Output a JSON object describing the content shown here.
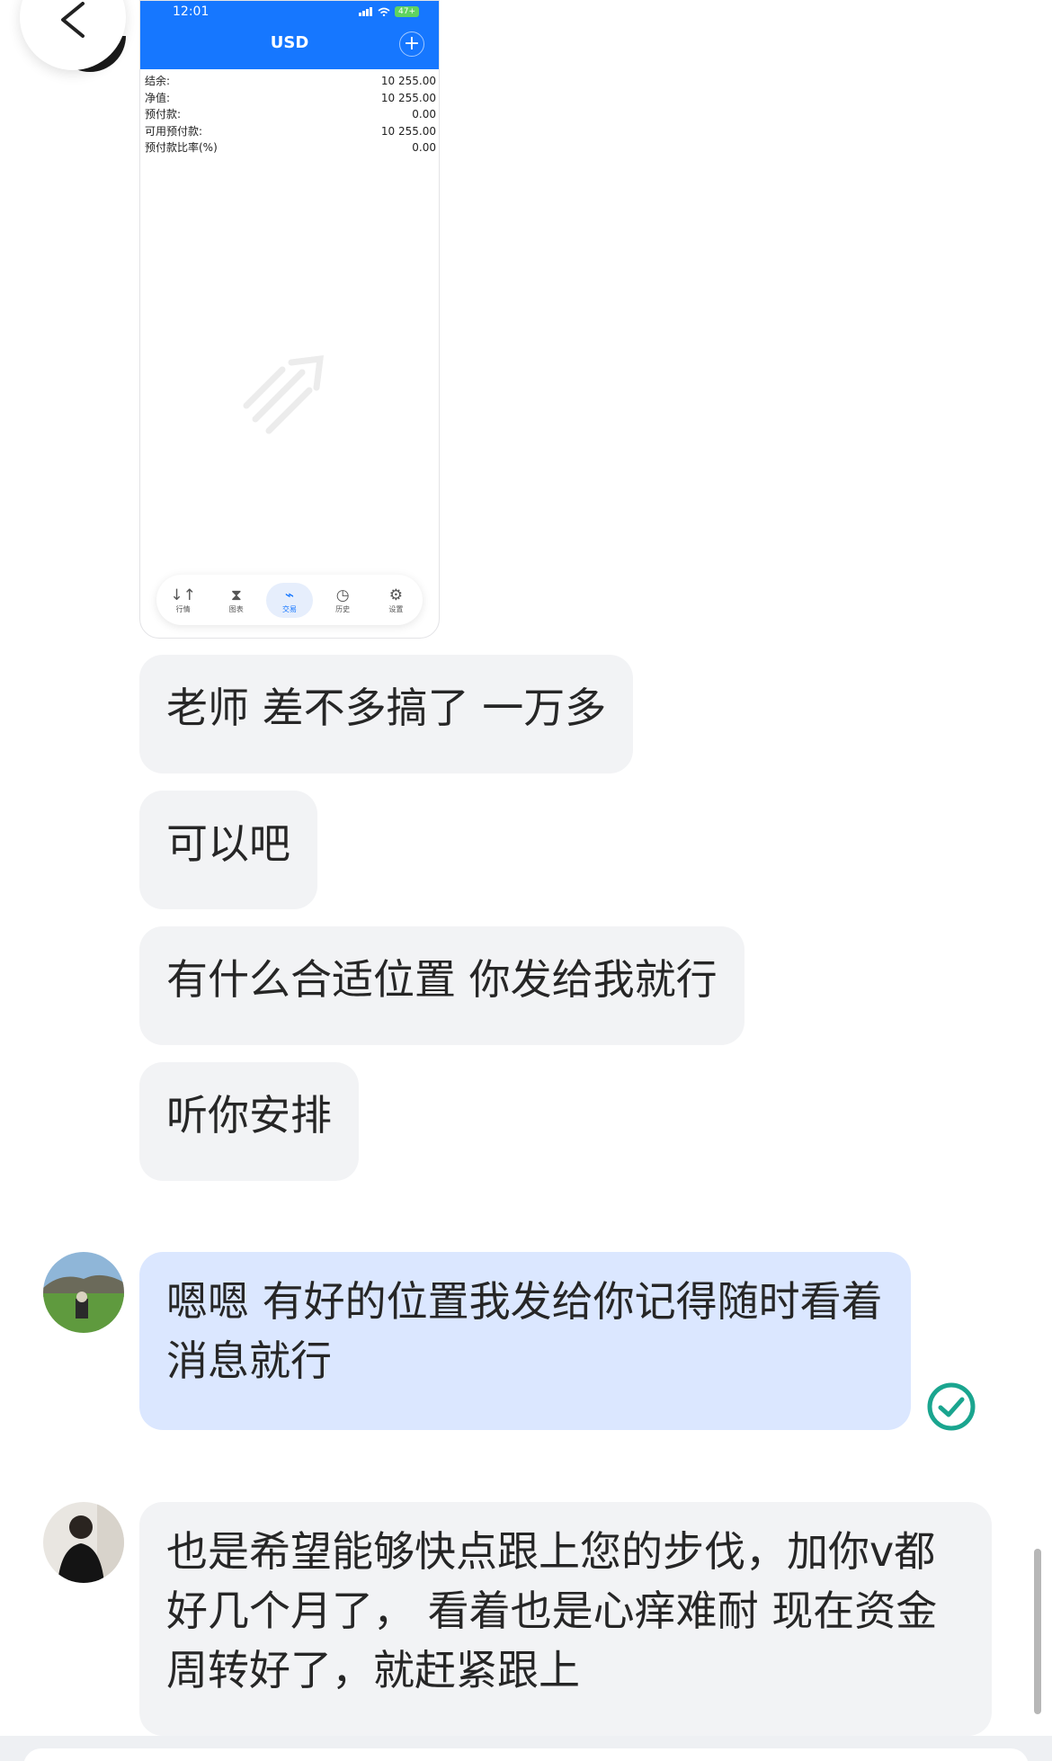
{
  "screenshot": {
    "time": "12:01",
    "battery": "47+",
    "title": "USD",
    "plus": "+",
    "rows": [
      {
        "label": "结余:",
        "value": "10 255.00"
      },
      {
        "label": "净值:",
        "value": "10 255.00"
      },
      {
        "label": "预付款:",
        "value": "0.00"
      },
      {
        "label": "可用预付款:",
        "value": "10 255.00"
      },
      {
        "label": "预付款比率(%)",
        "value": "0.00"
      }
    ],
    "nav": [
      {
        "label": "行情",
        "icon": "↓↑"
      },
      {
        "label": "图表",
        "icon": "⧗"
      },
      {
        "label": "交易",
        "icon": "⌁"
      },
      {
        "label": "历史",
        "icon": "◷"
      },
      {
        "label": "设置",
        "icon": "⚙"
      }
    ]
  },
  "messages": [
    {
      "text": "老师 差不多搞了 一万多"
    },
    {
      "text": "可以吧"
    },
    {
      "text": "有什么合适位置 你发给我就行"
    },
    {
      "text": "听你安排"
    },
    {
      "text": "嗯嗯  有好的位置我发给你记得随时看着消息就行"
    },
    {
      "text": "也是希望能够快点跟上您的步伐，加你v都好几个月了， 看着也是心痒难耐 现在资金周转好了，就赶紧跟上"
    }
  ],
  "colors": {
    "accent": "#1677ff",
    "bubble_gray": "#f2f3f5",
    "bubble_blue": "#dbe7ff",
    "check": "#1aa58f"
  }
}
